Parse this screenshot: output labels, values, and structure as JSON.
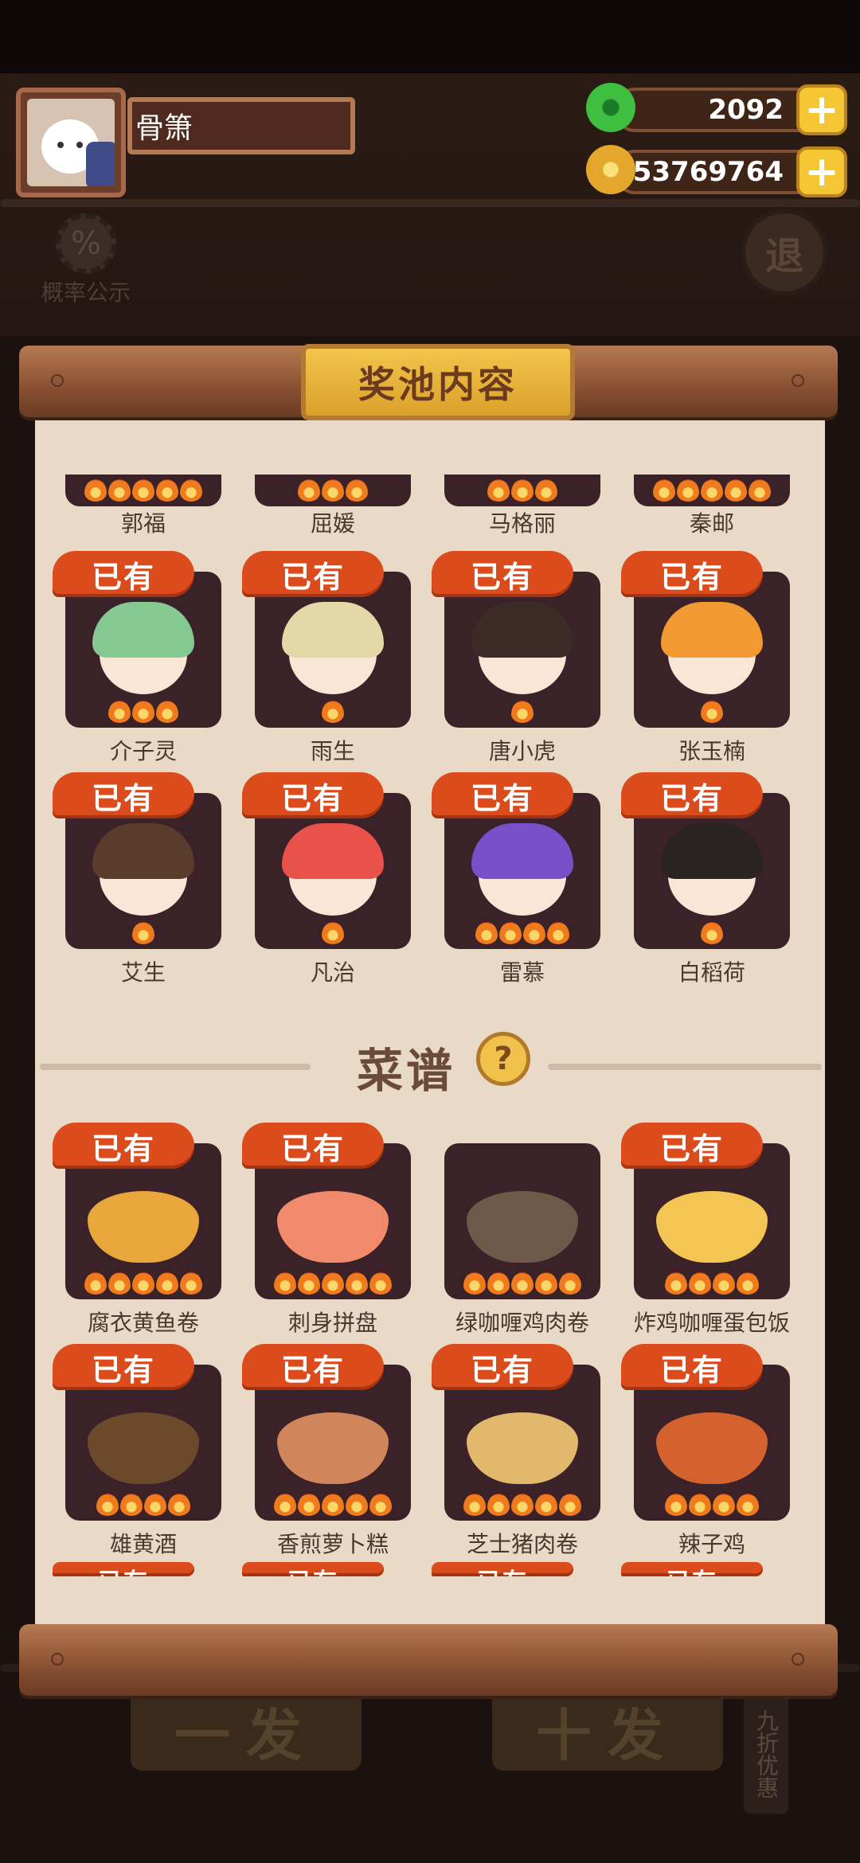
{
  "player": {
    "name": "骨箫"
  },
  "currency": {
    "jade": "2092",
    "coins": "53769764",
    "plus": "+"
  },
  "probability": {
    "label": "概率公示",
    "icon": "%"
  },
  "exit": {
    "label": "退"
  },
  "pool": {
    "title": "奖池内容"
  },
  "owned_tag": "已有",
  "chef_rows_partial": [
    "郭福",
    "屈媛",
    "马格丽",
    "秦邮"
  ],
  "chefs": [
    {
      "name": "介子灵",
      "owned": true
    },
    {
      "name": "雨生",
      "owned": true
    },
    {
      "name": "唐小虎",
      "owned": true
    },
    {
      "name": "张玉楠",
      "owned": true
    },
    {
      "name": "艾生",
      "owned": true
    },
    {
      "name": "凡治",
      "owned": true
    },
    {
      "name": "雷慕",
      "owned": true
    },
    {
      "name": "白稻荷",
      "owned": true
    }
  ],
  "recipes_section": {
    "title": "菜谱",
    "help": "?"
  },
  "recipes": [
    {
      "name": "腐衣黄鱼卷",
      "owned": true
    },
    {
      "name": "刺身拼盘",
      "owned": true
    },
    {
      "name": "绿咖喱鸡肉卷",
      "owned": false
    },
    {
      "name": "炸鸡咖喱蛋包饭",
      "owned": true
    },
    {
      "name": "雄黄酒",
      "owned": true
    },
    {
      "name": "香煎萝卜糕",
      "owned": true
    },
    {
      "name": "芝士猪肉卷",
      "owned": true
    },
    {
      "name": "辣子鸡",
      "owned": true
    }
  ],
  "bottom": {
    "single": "一发",
    "ten": "十发",
    "discount": "九折优惠"
  }
}
